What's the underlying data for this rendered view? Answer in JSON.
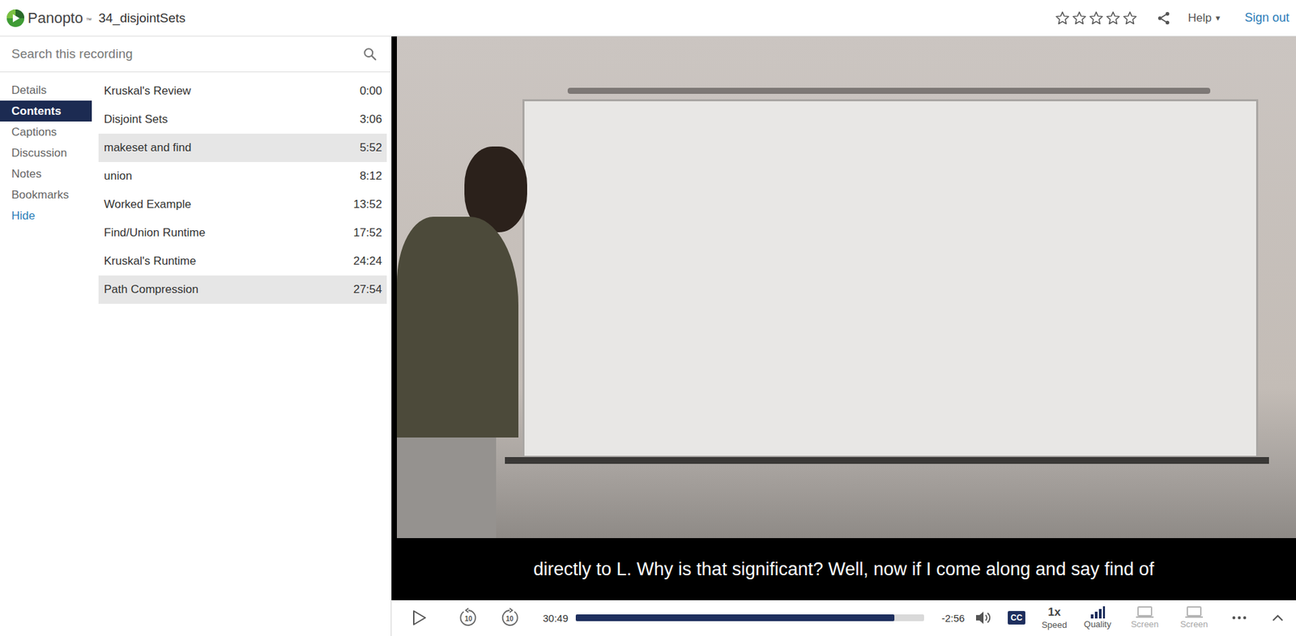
{
  "app": {
    "brand": "Panopto",
    "brand_mark": "™",
    "title": "34_disjointSets"
  },
  "header": {
    "stars": 0,
    "max_stars": 5,
    "help": "Help",
    "help_caret": "▾",
    "sign_out": "Sign out"
  },
  "search": {
    "placeholder": "Search this recording"
  },
  "tabs": [
    {
      "label": "Details",
      "selected": false,
      "kind": "tab"
    },
    {
      "label": "Contents",
      "selected": true,
      "kind": "tab"
    },
    {
      "label": "Captions",
      "selected": false,
      "kind": "tab"
    },
    {
      "label": "Discussion",
      "selected": false,
      "kind": "tab"
    },
    {
      "label": "Notes",
      "selected": false,
      "kind": "tab"
    },
    {
      "label": "Bookmarks",
      "selected": false,
      "kind": "tab"
    },
    {
      "label": "Hide",
      "selected": false,
      "kind": "link"
    }
  ],
  "contents": [
    {
      "title": "Kruskal's Review",
      "time": "0:00",
      "highlighted": false
    },
    {
      "title": "Disjoint Sets",
      "time": "3:06",
      "highlighted": false
    },
    {
      "title": "makeset and find",
      "time": "5:52",
      "highlighted": true
    },
    {
      "title": "union",
      "time": "8:12",
      "highlighted": false
    },
    {
      "title": "Worked Example",
      "time": "13:52",
      "highlighted": false
    },
    {
      "title": "Find/Union Runtime",
      "time": "17:52",
      "highlighted": false
    },
    {
      "title": "Kruskal's Runtime",
      "time": "24:24",
      "highlighted": false
    },
    {
      "title": "Path Compression",
      "time": "27:54",
      "highlighted": true
    }
  ],
  "caption": "directly to L. Why is that significant? Well, now if I come along and say find of",
  "player": {
    "skip_back": "10",
    "skip_forward": "10",
    "elapsed": "30:49",
    "progress": 0.914,
    "remaining": "-2:56",
    "cc": "CC",
    "speed_value": "1x",
    "speed_label": "Speed",
    "quality": "Quality",
    "screens": [
      {
        "label": "Screen",
        "disabled": true
      },
      {
        "label": "Screen",
        "disabled": true
      }
    ]
  }
}
